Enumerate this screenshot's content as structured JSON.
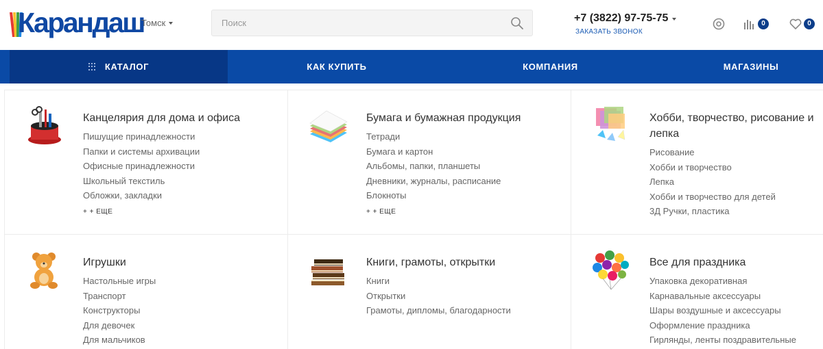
{
  "header": {
    "logo_text": "Карандаш",
    "city": "Томск",
    "search_placeholder": "Поиск",
    "phone": "+7 (3822) 97-75-75",
    "callback_label": "ЗАКАЗАТЬ ЗВОНОК",
    "compare_count": "0",
    "favorites_count": "0",
    "colors": {
      "brand": "#0f48a3",
      "nav": "#0a4aa6",
      "nav_active": "#073786",
      "badge": "#0c3e8a"
    }
  },
  "nav": {
    "catalog": "КАТАЛОГ",
    "how_to_buy": "КАК КУПИТЬ",
    "company": "КОМПАНИЯ",
    "stores": "МАГАЗИНЫ"
  },
  "catalog": {
    "categories": [
      {
        "title": "Канцелярия для дома и офиса",
        "icon": "desk-organizer-icon",
        "links": [
          "Пишущие принадлежности",
          "Папки и системы архивации",
          "Офисные принадлежности",
          "Школьный текстиль",
          "Обложки, закладки"
        ],
        "more": "+ + ЕЩЕ"
      },
      {
        "title": "Бумага и бумажная продукция",
        "icon": "paper-stack-icon",
        "links": [
          "Тетради",
          "Бумага и картон",
          "Альбомы, папки, планшеты",
          "Дневники, журналы, расписание",
          "Блокноты"
        ],
        "more": "+ + ЕЩЕ"
      },
      {
        "title": "Хобби, творчество, рисование и лепка",
        "icon": "origami-icon",
        "links": [
          "Рисование",
          "Хобби и творчество",
          "Лепка",
          "Хобби и творчество для детей",
          "3Д Ручки, пластика"
        ],
        "more": ""
      },
      {
        "title": "Игрушки",
        "icon": "teddy-bear-icon",
        "links": [
          "Настольные игры",
          "Транспорт",
          "Конструкторы",
          "Для девочек",
          "Для мальчиков"
        ],
        "more": ""
      },
      {
        "title": "Книги, грамоты, открытки",
        "icon": "books-icon",
        "links": [
          "Книги",
          "Открытки",
          "Грамоты, дипломы, благодарности"
        ],
        "more": ""
      },
      {
        "title": "Все для праздника",
        "icon": "balloons-icon",
        "links": [
          "Упаковка декоративная",
          "Карнавальные аксессуары",
          "Шары воздушные и аксессуары",
          "Оформление праздника",
          "Гирлянды, ленты поздравительные"
        ],
        "more": ""
      }
    ]
  }
}
